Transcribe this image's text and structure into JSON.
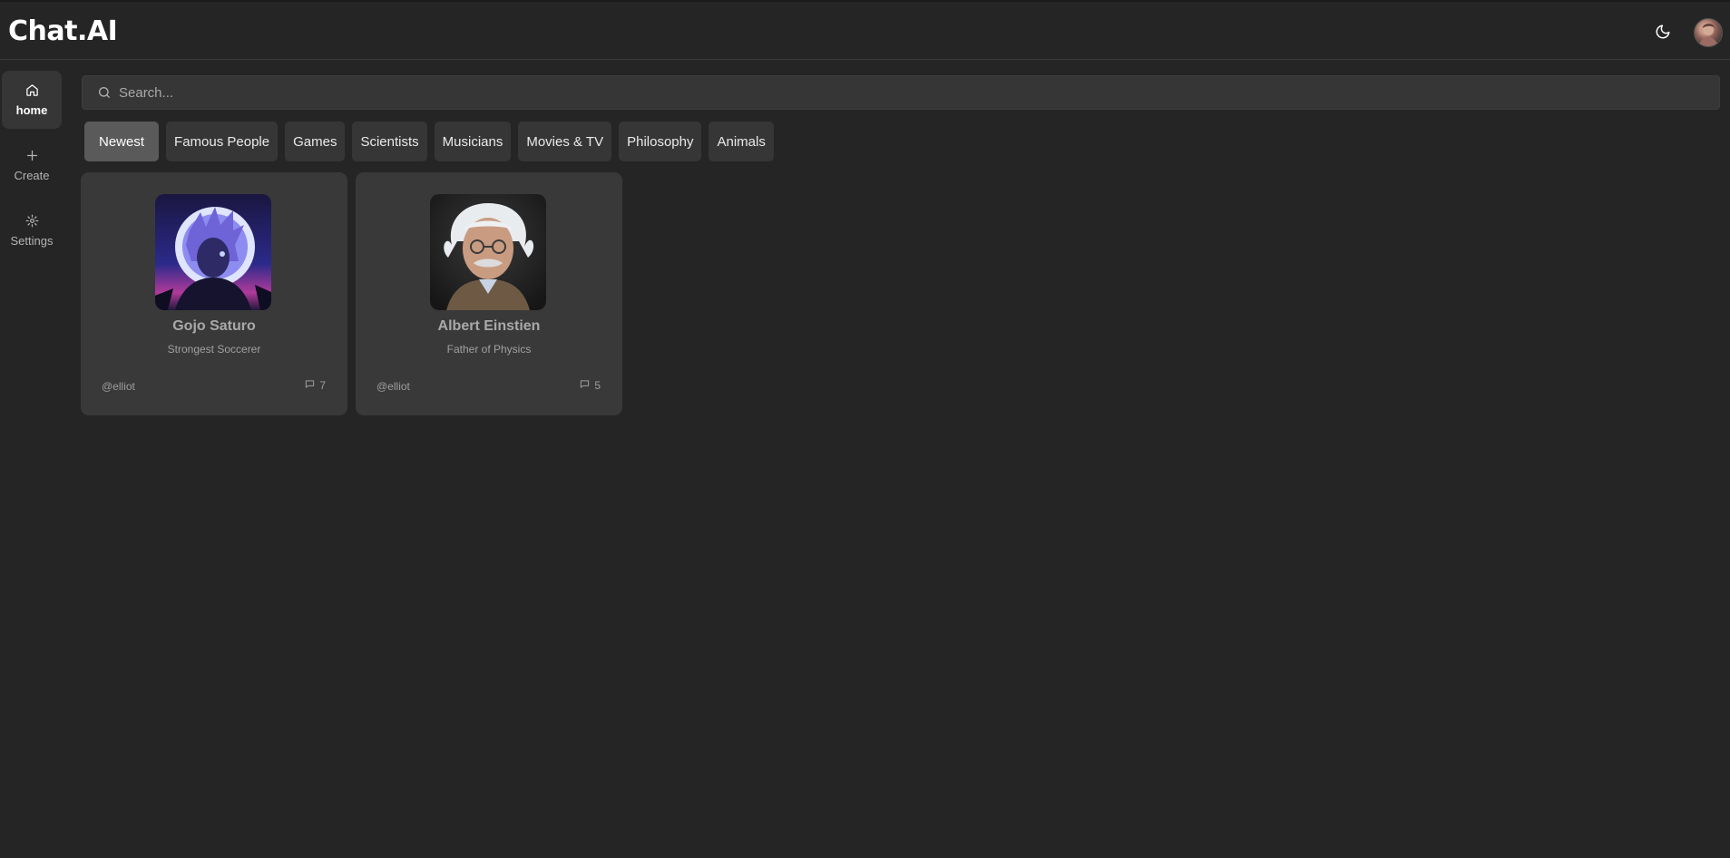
{
  "header": {
    "logo": "Chat.AI",
    "theme_toggle_icon": "moon-icon",
    "avatar_icon": "user-avatar"
  },
  "sidebar": {
    "items": [
      {
        "label": "home",
        "icon": "home-icon",
        "active": true
      },
      {
        "label": "Create",
        "icon": "plus-icon",
        "active": false
      },
      {
        "label": "Settings",
        "icon": "gear-icon",
        "active": false
      }
    ]
  },
  "search": {
    "placeholder": "Search...",
    "value": "",
    "icon": "search-icon"
  },
  "categories": [
    {
      "label": "Newest",
      "active": true
    },
    {
      "label": "Famous People",
      "active": false
    },
    {
      "label": "Games",
      "active": false
    },
    {
      "label": "Scientists",
      "active": false
    },
    {
      "label": "Musicians",
      "active": false
    },
    {
      "label": "Movies & TV",
      "active": false
    },
    {
      "label": "Philosophy",
      "active": false
    },
    {
      "label": "Animals",
      "active": false
    }
  ],
  "companions": [
    {
      "name": "Gojo Saturo",
      "description": "Strongest Soccerer",
      "author": "@elliot",
      "messages": "7"
    },
    {
      "name": "Albert Einstien",
      "description": "Father of Physics",
      "author": "@elliot",
      "messages": "5"
    }
  ],
  "colors": {
    "background": "#252525",
    "surface": "#393939",
    "active_tab": "#5a5a5a"
  }
}
